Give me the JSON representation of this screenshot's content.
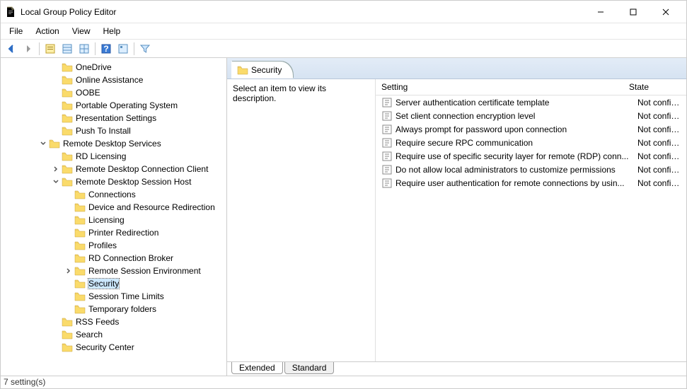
{
  "window": {
    "title": "Local Group Policy Editor"
  },
  "menu": [
    "File",
    "Action",
    "View",
    "Help"
  ],
  "tree": [
    {
      "depth": 4,
      "twist": "none",
      "label": "OneDrive"
    },
    {
      "depth": 4,
      "twist": "none",
      "label": "Online Assistance"
    },
    {
      "depth": 4,
      "twist": "none",
      "label": "OOBE"
    },
    {
      "depth": 4,
      "twist": "none",
      "label": "Portable Operating System"
    },
    {
      "depth": 4,
      "twist": "none",
      "label": "Presentation Settings"
    },
    {
      "depth": 4,
      "twist": "none",
      "label": "Push To Install"
    },
    {
      "depth": 3,
      "twist": "open",
      "label": "Remote Desktop Services"
    },
    {
      "depth": 4,
      "twist": "none",
      "label": "RD Licensing"
    },
    {
      "depth": 4,
      "twist": "closed",
      "label": "Remote Desktop Connection Client"
    },
    {
      "depth": 4,
      "twist": "open",
      "label": "Remote Desktop Session Host"
    },
    {
      "depth": 5,
      "twist": "none",
      "label": "Connections"
    },
    {
      "depth": 5,
      "twist": "none",
      "label": "Device and Resource Redirection"
    },
    {
      "depth": 5,
      "twist": "none",
      "label": "Licensing"
    },
    {
      "depth": 5,
      "twist": "none",
      "label": "Printer Redirection"
    },
    {
      "depth": 5,
      "twist": "none",
      "label": "Profiles"
    },
    {
      "depth": 5,
      "twist": "none",
      "label": "RD Connection Broker"
    },
    {
      "depth": 5,
      "twist": "closed",
      "label": "Remote Session Environment"
    },
    {
      "depth": 5,
      "twist": "none",
      "label": "Security",
      "selected": true
    },
    {
      "depth": 5,
      "twist": "none",
      "label": "Session Time Limits"
    },
    {
      "depth": 5,
      "twist": "none",
      "label": "Temporary folders"
    },
    {
      "depth": 4,
      "twist": "none",
      "label": "RSS Feeds"
    },
    {
      "depth": 4,
      "twist": "none",
      "label": "Search"
    },
    {
      "depth": 4,
      "twist": "none",
      "label": "Security Center"
    }
  ],
  "detail": {
    "folder": "Security",
    "description": "Select an item to view its description.",
    "columns": {
      "setting": "Setting",
      "state": "State"
    },
    "settings": [
      {
        "label": "Server authentication certificate template",
        "state": "Not configured"
      },
      {
        "label": "Set client connection encryption level",
        "state": "Not configured"
      },
      {
        "label": "Always prompt for password upon connection",
        "state": "Not configured"
      },
      {
        "label": "Require secure RPC communication",
        "state": "Not configured"
      },
      {
        "label": "Require use of specific security layer for remote (RDP) conn...",
        "state": "Not configured"
      },
      {
        "label": "Do not allow local administrators to customize permissions",
        "state": "Not configured"
      },
      {
        "label": "Require user authentication for remote connections by usin...",
        "state": "Not configured"
      }
    ],
    "tabs": [
      "Extended",
      "Standard"
    ],
    "active_tab": 0
  },
  "status": "7 setting(s)"
}
